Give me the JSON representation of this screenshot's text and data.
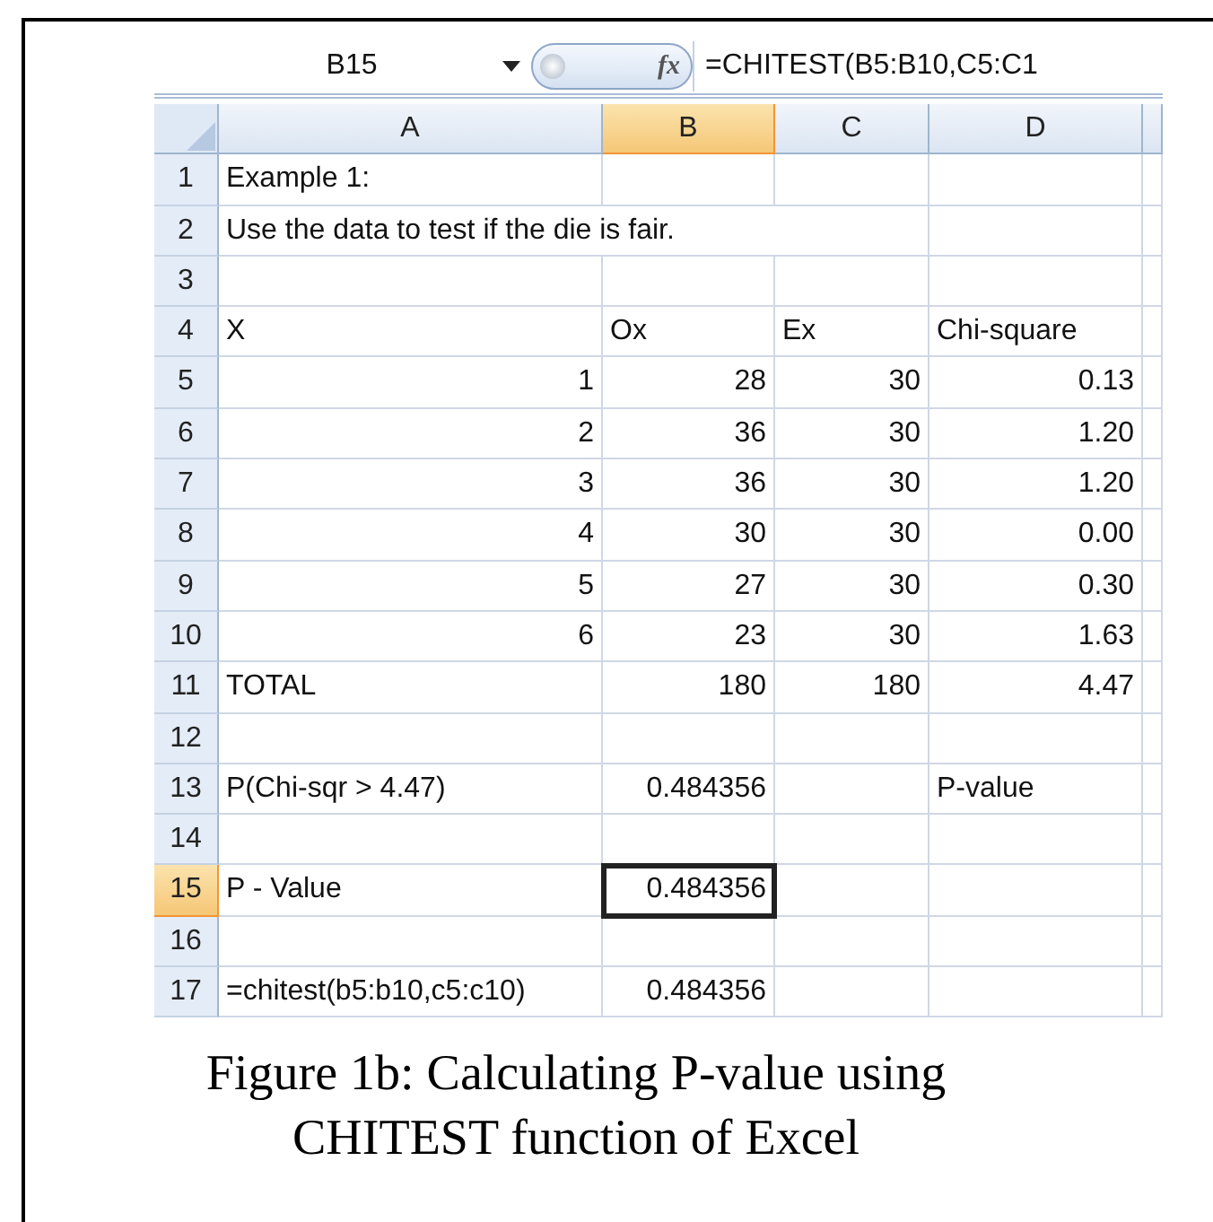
{
  "formula_bar": {
    "name_box": "B15",
    "function_label": "fx",
    "formula": "=CHITEST(B5:B10,C5:C1"
  },
  "columns": [
    {
      "label": "A",
      "selected": false
    },
    {
      "label": "B",
      "selected": true
    },
    {
      "label": "C",
      "selected": false
    },
    {
      "label": "D",
      "selected": false
    }
  ],
  "rows": [
    {
      "number": "1",
      "selected": false,
      "cells": [
        {
          "kind": "text",
          "text": "Example 1:"
        },
        {
          "kind": "empty"
        },
        {
          "kind": "empty"
        },
        {
          "kind": "empty"
        }
      ]
    },
    {
      "number": "2",
      "selected": false,
      "cells": [
        {
          "kind": "overflow",
          "text": "Use the data to test if the die is fair."
        },
        {
          "kind": "empty"
        },
        {
          "kind": "empty"
        },
        {
          "kind": "empty"
        }
      ]
    },
    {
      "number": "3",
      "selected": false,
      "cells": [
        {
          "kind": "empty"
        },
        {
          "kind": "empty"
        },
        {
          "kind": "empty"
        },
        {
          "kind": "empty"
        }
      ]
    },
    {
      "number": "4",
      "selected": false,
      "cells": [
        {
          "kind": "text",
          "text": "X"
        },
        {
          "kind": "text",
          "text": "Ox"
        },
        {
          "kind": "text",
          "text": "Ex"
        },
        {
          "kind": "text",
          "text": "Chi-square"
        }
      ]
    },
    {
      "number": "5",
      "selected": false,
      "cells": [
        {
          "kind": "number",
          "text": "1"
        },
        {
          "kind": "number",
          "text": "28"
        },
        {
          "kind": "number",
          "text": "30"
        },
        {
          "kind": "number",
          "text": "0.13"
        }
      ]
    },
    {
      "number": "6",
      "selected": false,
      "cells": [
        {
          "kind": "number",
          "text": "2"
        },
        {
          "kind": "number",
          "text": "36"
        },
        {
          "kind": "number",
          "text": "30"
        },
        {
          "kind": "number",
          "text": "1.20"
        }
      ]
    },
    {
      "number": "7",
      "selected": false,
      "cells": [
        {
          "kind": "number",
          "text": "3"
        },
        {
          "kind": "number",
          "text": "36"
        },
        {
          "kind": "number",
          "text": "30"
        },
        {
          "kind": "number",
          "text": "1.20"
        }
      ]
    },
    {
      "number": "8",
      "selected": false,
      "cells": [
        {
          "kind": "number",
          "text": "4"
        },
        {
          "kind": "number",
          "text": "30"
        },
        {
          "kind": "number",
          "text": "30"
        },
        {
          "kind": "number",
          "text": "0.00"
        }
      ]
    },
    {
      "number": "9",
      "selected": false,
      "cells": [
        {
          "kind": "number",
          "text": "5"
        },
        {
          "kind": "number",
          "text": "27"
        },
        {
          "kind": "number",
          "text": "30"
        },
        {
          "kind": "number",
          "text": "0.30"
        }
      ]
    },
    {
      "number": "10",
      "selected": false,
      "cells": [
        {
          "kind": "number",
          "text": "6"
        },
        {
          "kind": "number",
          "text": "23"
        },
        {
          "kind": "number",
          "text": "30"
        },
        {
          "kind": "number",
          "text": "1.63"
        }
      ]
    },
    {
      "number": "11",
      "selected": false,
      "cells": [
        {
          "kind": "text",
          "text": "TOTAL"
        },
        {
          "kind": "number",
          "text": "180"
        },
        {
          "kind": "number",
          "text": "180"
        },
        {
          "kind": "number",
          "text": "4.47"
        }
      ]
    },
    {
      "number": "12",
      "selected": false,
      "cells": [
        {
          "kind": "empty"
        },
        {
          "kind": "empty"
        },
        {
          "kind": "empty"
        },
        {
          "kind": "empty"
        }
      ]
    },
    {
      "number": "13",
      "selected": false,
      "cells": [
        {
          "kind": "text",
          "text": "P(Chi-sqr > 4.47)"
        },
        {
          "kind": "number",
          "text": "0.484356"
        },
        {
          "kind": "empty"
        },
        {
          "kind": "text",
          "text": "P-value"
        }
      ]
    },
    {
      "number": "14",
      "selected": false,
      "cells": [
        {
          "kind": "empty"
        },
        {
          "kind": "empty"
        },
        {
          "kind": "empty"
        },
        {
          "kind": "empty"
        }
      ]
    },
    {
      "number": "15",
      "selected": true,
      "cells": [
        {
          "kind": "text",
          "text": "P - Value"
        },
        {
          "kind": "number",
          "text": "0.484356"
        },
        {
          "kind": "empty"
        },
        {
          "kind": "empty"
        }
      ]
    },
    {
      "number": "16",
      "selected": false,
      "cells": [
        {
          "kind": "empty"
        },
        {
          "kind": "empty"
        },
        {
          "kind": "empty"
        },
        {
          "kind": "empty"
        }
      ]
    },
    {
      "number": "17",
      "selected": false,
      "cells": [
        {
          "kind": "text",
          "text": "=chitest(b5:b10,c5:c10)"
        },
        {
          "kind": "number",
          "text": "0.484356"
        },
        {
          "kind": "empty"
        },
        {
          "kind": "empty"
        }
      ]
    }
  ],
  "caption": "Figure 1b: Calculating P-value using CHITEST function of Excel"
}
